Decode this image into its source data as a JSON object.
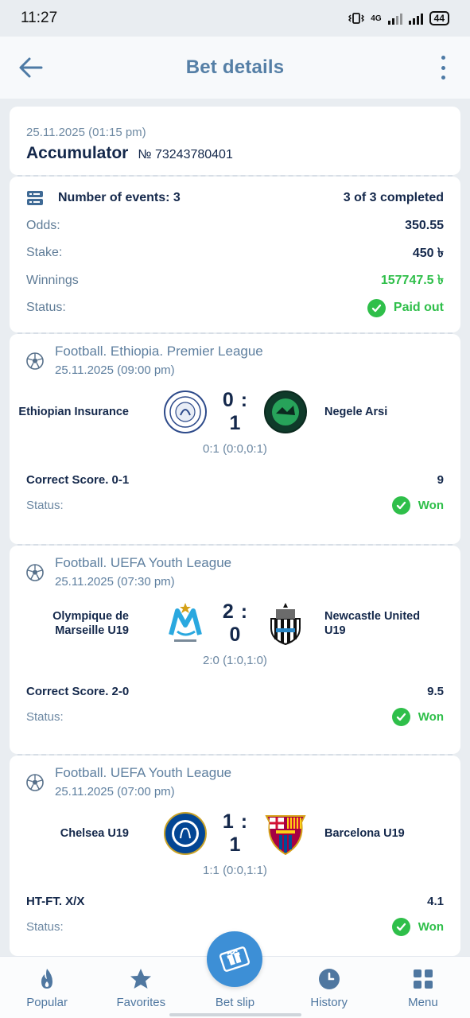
{
  "status_bar": {
    "time": "11:27",
    "network": "4G",
    "battery": "44"
  },
  "header": {
    "title": "Bet details"
  },
  "bet": {
    "date": "25.11.2025 (01:15 pm)",
    "type": "Accumulator",
    "number": "№ 73243780401",
    "events_label": "Number of events: 3",
    "events_completed": "3 of 3 completed",
    "odds_label": "Odds:",
    "odds_value": "350.55",
    "stake_label": "Stake:",
    "stake_value": "450 ৳",
    "winnings_label": "Winnings",
    "winnings_value": "157747.5 ৳",
    "status_label": "Status:",
    "status_value": "Paid out",
    "accent_green": "#2fbf4a"
  },
  "events": [
    {
      "league": "Football. Ethiopia. Premier League",
      "date": "25.11.2025 (09:00 pm)",
      "home": "Ethiopian Insurance",
      "away": "Negele Arsi",
      "score": "0 : 1",
      "sub_score": "0:1 (0:0,0:1)",
      "market": "Correct Score. 0-1",
      "odds": "9",
      "status_label": "Status:",
      "status_value": "Won"
    },
    {
      "league": "Football. UEFA Youth League",
      "date": "25.11.2025 (07:30 pm)",
      "home": "Olympique de Marseille U19",
      "away": "Newcastle United U19",
      "score": "2 : 0",
      "sub_score": "2:0 (1:0,1:0)",
      "market": "Correct Score. 2-0",
      "odds": "9.5",
      "status_label": "Status:",
      "status_value": "Won"
    },
    {
      "league": "Football. UEFA Youth League",
      "date": "25.11.2025 (07:00 pm)",
      "home": "Chelsea U19",
      "away": "Barcelona U19",
      "score": "1 : 1",
      "sub_score": "1:1 (0:0,1:1)",
      "market": "HT-FT. X/X",
      "odds": "4.1",
      "status_label": "Status:",
      "status_value": "Won"
    }
  ],
  "nav": {
    "popular": "Popular",
    "favorites": "Favorites",
    "betslip": "Bet slip",
    "history": "History",
    "menu": "Menu"
  }
}
